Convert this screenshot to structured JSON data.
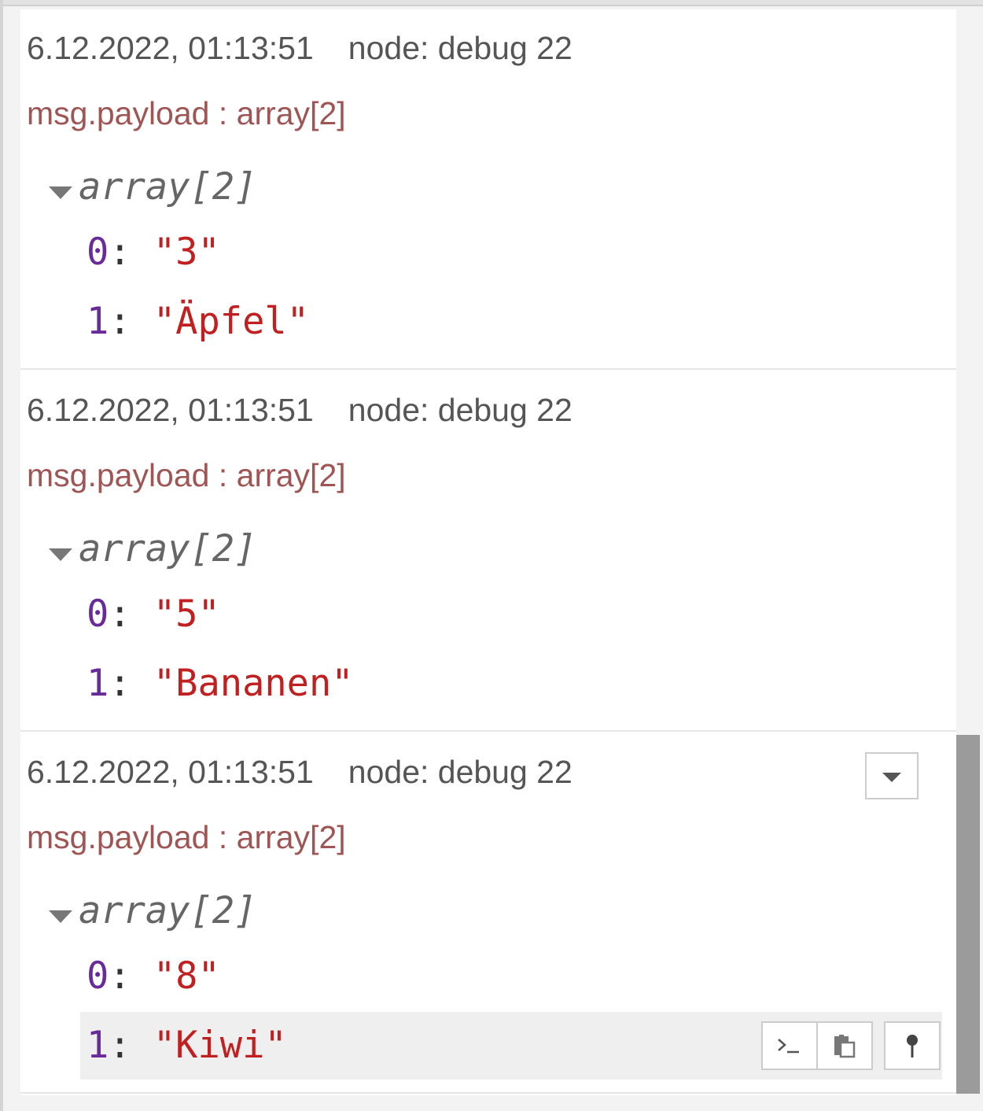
{
  "messages": [
    {
      "timestamp": "6.12.2022, 01:13:51",
      "node": "node: debug 22",
      "topic": "msg.payload : array[2]",
      "type_label": "array[2]",
      "items": [
        {
          "index": "0",
          "value": "\"3\""
        },
        {
          "index": "1",
          "value": "\"Äpfel\""
        }
      ]
    },
    {
      "timestamp": "6.12.2022, 01:13:51",
      "node": "node: debug 22",
      "topic": "msg.payload : array[2]",
      "type_label": "array[2]",
      "items": [
        {
          "index": "0",
          "value": "\"5\""
        },
        {
          "index": "1",
          "value": "\"Bananen\""
        }
      ]
    },
    {
      "timestamp": "6.12.2022, 01:13:51",
      "node": "node: debug 22",
      "topic": "msg.payload : array[2]",
      "type_label": "array[2]",
      "items": [
        {
          "index": "0",
          "value": "\"8\""
        },
        {
          "index": "1",
          "value": "\"Kiwi\""
        }
      ]
    }
  ],
  "row_tools": {
    "copy_path_icon": "terminal-icon",
    "copy_value_icon": "clipboard-icon",
    "pin_icon": "pin-icon"
  },
  "colors": {
    "index": "#6a2b9a",
    "string_value": "#c02020",
    "topic": "#a05555",
    "scroll_thumb": "#9b9b9b"
  }
}
